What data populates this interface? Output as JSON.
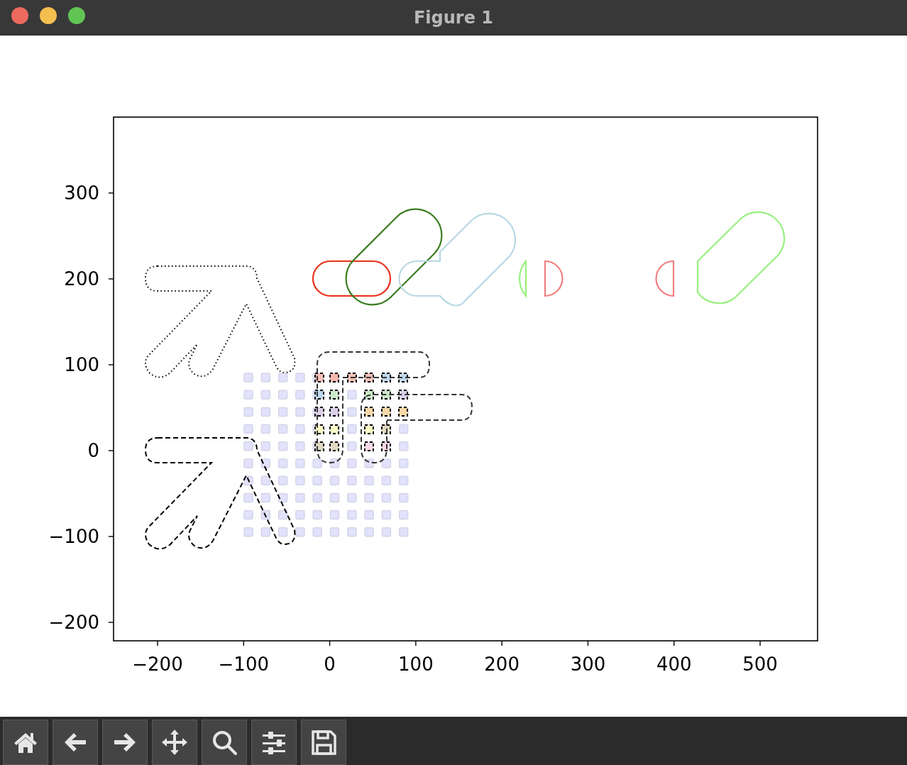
{
  "window": {
    "title": "Figure 1"
  },
  "axes": {
    "yticks": [
      "300",
      "200",
      "100",
      "0",
      "−100",
      "−200"
    ],
    "xticks": [
      "−200",
      "−100",
      "0",
      "100",
      "200",
      "300",
      "400",
      "500"
    ]
  },
  "toolbar": [
    {
      "kind": "home"
    },
    {
      "kind": "back"
    },
    {
      "kind": "forward"
    },
    {
      "kind": "pan"
    },
    {
      "kind": "zoom"
    },
    {
      "kind": "configure"
    },
    {
      "kind": "save"
    }
  ]
}
